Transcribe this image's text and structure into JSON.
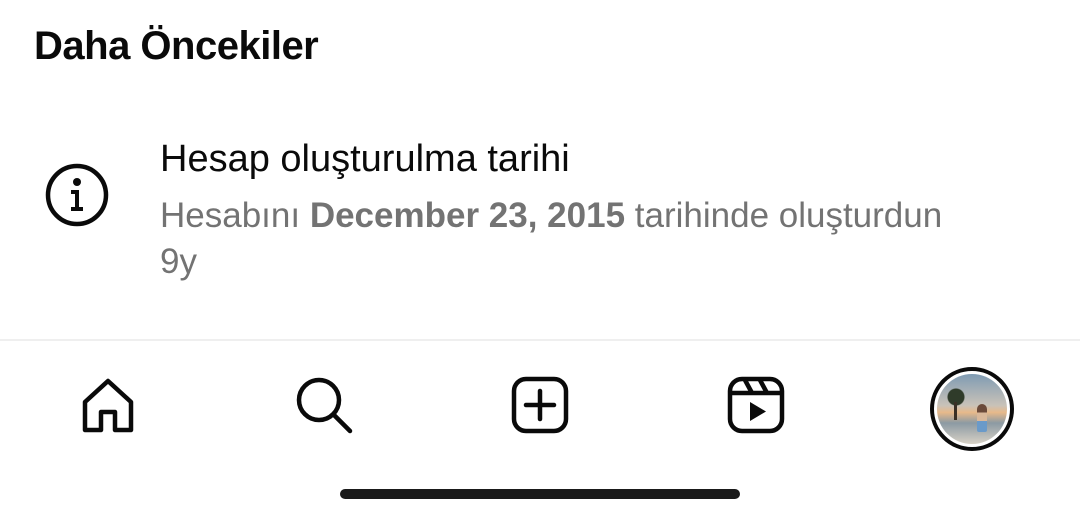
{
  "section": {
    "title": "Daha Öncekiler"
  },
  "notification": {
    "icon": "info-circle-icon",
    "title": "Hesap oluşturulma tarihi",
    "body_prefix": "Hesabını ",
    "body_date": "December 23, 2015",
    "body_suffix": " tarihinde oluşturdun",
    "time": "9y"
  },
  "tabbar": {
    "items": [
      {
        "name": "home",
        "icon": "home-icon"
      },
      {
        "name": "search",
        "icon": "search-icon"
      },
      {
        "name": "create",
        "icon": "plus-square-icon"
      },
      {
        "name": "reels",
        "icon": "reels-icon"
      },
      {
        "name": "profile",
        "icon": "avatar"
      }
    ]
  },
  "colors": {
    "primary_text": "#0a0a0a",
    "secondary_text": "#737373",
    "divider": "#efefef",
    "background": "#ffffff"
  }
}
